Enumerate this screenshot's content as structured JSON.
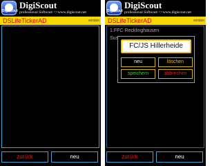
{
  "header": {
    "brand": "DigiScout",
    "tagline": "professional Software <>www.digiscout.net",
    "logo_text": "Digiscout"
  },
  "app": {
    "title": "DSLifeTickerAD",
    "version_label": "version"
  },
  "buttons": {
    "back": "zurück",
    "new": "neu"
  },
  "list": {
    "item1": "1.FFC Recklinghausen",
    "item2_partial": "Sus"
  },
  "dialog": {
    "input_value": "FC/JS Hillerheide",
    "btn_new": "neu",
    "btn_delete": "löschen",
    "btn_save": "speichern",
    "btn_cancel": "abbrechen"
  },
  "colors": {
    "titlebar_bg": "#f7d800",
    "title_text": "#d10000",
    "accent_blue": "#3aa9d9",
    "save_green": "#33d13a",
    "delete_yellow": "#f0c000",
    "cancel_red": "#e21b1b"
  }
}
